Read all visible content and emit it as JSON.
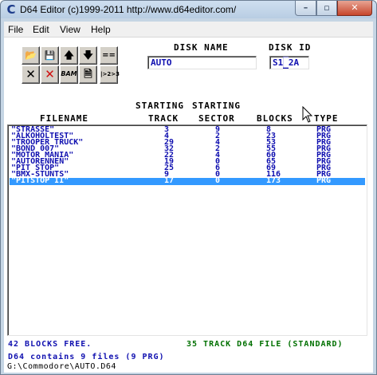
{
  "window": {
    "title": "D64 Editor (c)1999-2011 http://www.d64editor.com/"
  },
  "menu": [
    "File",
    "Edit",
    "View",
    "Help"
  ],
  "toolbar": {
    "buttons": [
      {
        "name": "open-icon",
        "glyph": "📂"
      },
      {
        "name": "save-icon",
        "glyph": "💾"
      },
      {
        "name": "move-up-icon",
        "glyph": "🡅"
      },
      {
        "name": "move-down-icon",
        "glyph": "🡇"
      },
      {
        "name": "separator-entry-icon",
        "glyph": "=="
      },
      {
        "name": "cancel-icon",
        "glyph": "✕"
      },
      {
        "name": "delete-icon",
        "glyph": "✕"
      },
      {
        "name": "bam-icon",
        "glyph": "BAM"
      },
      {
        "name": "document-icon",
        "glyph": "🗎"
      },
      {
        "name": "convert-icon",
        "glyph": "|>2>3"
      }
    ]
  },
  "disk": {
    "name_label": "DISK NAME",
    "id_label": "DISK ID",
    "name_value": "AUTO",
    "id_value_prefix": "S1",
    "id_value_cursor": "█",
    "id_value_suffix": "2A"
  },
  "headers": {
    "starting_track_top": "STARTING",
    "starting_sector_top": "STARTING",
    "filename": "FILENAME",
    "track": "TRACK",
    "sector": "SECTOR",
    "blocks": "BLOCKS",
    "type": "TYPE"
  },
  "files": [
    {
      "filename": "\"STRASSE\"",
      "track": "3",
      "sector": "9",
      "blocks": "8",
      "type": "PRG"
    },
    {
      "filename": "\"ALKOHOLTEST\"",
      "track": "4",
      "sector": "2",
      "blocks": "23",
      "type": "PRG"
    },
    {
      "filename": "\"TROOPER TRUCK\"",
      "track": "29",
      "sector": "4",
      "blocks": "53",
      "type": "PRG"
    },
    {
      "filename": "\"BOND 007\"",
      "track": "32",
      "sector": "2",
      "blocks": "55",
      "type": "PRG"
    },
    {
      "filename": "\"MOTOR MANIA\"",
      "track": "22",
      "sector": "4",
      "blocks": "60",
      "type": "PRG"
    },
    {
      "filename": "\"AUTORENNEN\"",
      "track": "19",
      "sector": "0",
      "blocks": "65",
      "type": "PRG"
    },
    {
      "filename": "\"PIT STOP\"",
      "track": "25",
      "sector": "6",
      "blocks": "69",
      "type": "PRG"
    },
    {
      "filename": "\"BMX-STUNTS\"",
      "track": "9",
      "sector": "0",
      "blocks": "116",
      "type": "PRG"
    },
    {
      "filename": "\"PITSTOP II\"",
      "track": "17",
      "sector": "0",
      "blocks": "173",
      "type": "PRG",
      "selected": true
    }
  ],
  "status": {
    "blocks_free": "42 BLOCKS FREE.",
    "disk_format": "35 TRACK D64 FILE (STANDARD)",
    "file_count": "D64 contains 9 files (9 PRG)",
    "path": "G:\\Commodore\\AUTO.D64"
  },
  "colors": {
    "text_blue": "#1010b0",
    "selection": "#3399ff",
    "status_green": "#007000"
  }
}
